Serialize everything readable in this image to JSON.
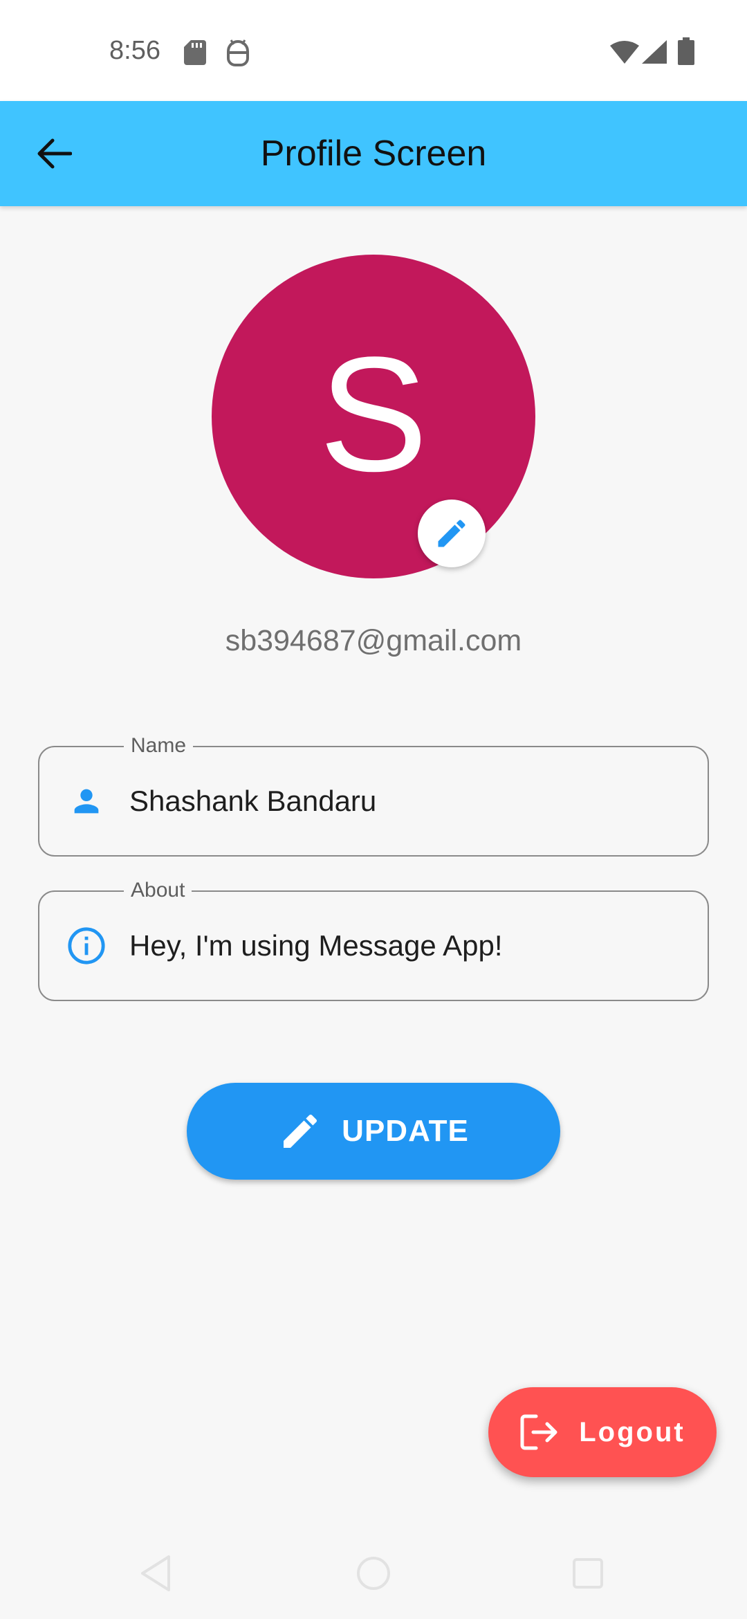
{
  "status_bar": {
    "time": "8:56",
    "icons": [
      "sd-card-icon",
      "android-icon",
      "wifi-icon",
      "signal-icon",
      "battery-icon"
    ]
  },
  "app_bar": {
    "title": "Profile Screen",
    "back_icon": "arrow-back-icon"
  },
  "profile": {
    "avatar_letter": "S",
    "avatar_color": "#c2185b",
    "edit_icon": "pencil-icon",
    "email": "sb394687@gmail.com"
  },
  "form": {
    "name": {
      "label": "Name",
      "value": "Shashank Bandaru",
      "icon": "person-icon"
    },
    "about": {
      "label": "About",
      "value": "Hey, I'm using Message App!",
      "icon": "info-icon"
    }
  },
  "buttons": {
    "update_label": "UPDATE",
    "logout_label": "Logout"
  },
  "colors": {
    "app_bar": "#40c4ff",
    "accent_blue": "#2196f3",
    "logout_red": "#ff5252"
  },
  "nav_bar": {
    "icons": [
      "nav-back-icon",
      "nav-home-icon",
      "nav-recents-icon"
    ]
  }
}
